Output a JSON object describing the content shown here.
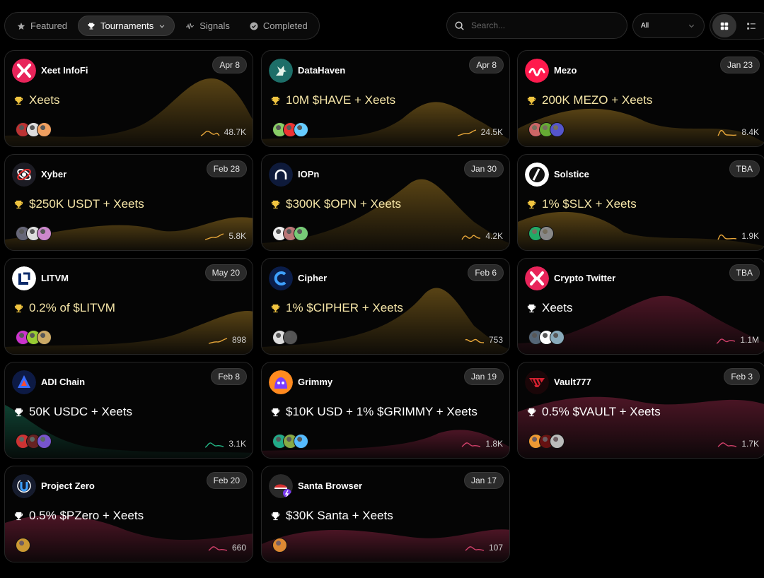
{
  "tabs": [
    {
      "label": "Featured",
      "icon": "star-icon",
      "active": false
    },
    {
      "label": "Tournaments",
      "icon": "trophy-icon",
      "active": true
    },
    {
      "label": "Signals",
      "icon": "signal-wave-icon",
      "active": false
    },
    {
      "label": "Completed",
      "icon": "check-circle-icon",
      "active": false
    }
  ],
  "search": {
    "placeholder": "Search..."
  },
  "filter": {
    "selected": "All"
  },
  "view": {
    "active": "grid"
  },
  "colors": {
    "gold": "#e0a82e",
    "pink": "#c0305a",
    "green": "#1fa37a"
  },
  "cards": [
    {
      "name": "Xeet InfoFi",
      "date": "Apr 8",
      "prize": "Xeets",
      "stat": "48.7K",
      "theme": "gold",
      "logo": "xeet-logo-icon"
    },
    {
      "name": "DataHaven",
      "date": "Apr 8",
      "prize": "10M $HAVE + Xeets",
      "stat": "24.5K",
      "theme": "gold",
      "logo": "datahaven-logo-icon"
    },
    {
      "name": "Mezo",
      "date": "Jan 23",
      "prize": "200K MEZO + Xeets",
      "stat": "8.4K",
      "theme": "gold",
      "logo": "mezo-logo-icon"
    },
    {
      "name": "Xyber",
      "date": "Feb 28",
      "prize": "$250K USDT + Xeets",
      "stat": "5.8K",
      "theme": "gold",
      "logo": "xyber-logo-icon"
    },
    {
      "name": "IOPn",
      "date": "Jan 30",
      "prize": "$300K $OPN + Xeets",
      "stat": "4.2K",
      "theme": "gold",
      "logo": "iopn-logo-icon"
    },
    {
      "name": "Solstice",
      "date": "TBA",
      "prize": "1% $SLX + Xeets",
      "stat": "1.9K",
      "theme": "gold",
      "logo": "solstice-logo-icon"
    },
    {
      "name": "LITVM",
      "date": "May 20",
      "prize": "0.2% of $LITVM",
      "stat": "898",
      "theme": "gold",
      "logo": "litvm-logo-icon"
    },
    {
      "name": "Cipher",
      "date": "Feb 6",
      "prize": "1% $CIPHER + Xeets",
      "stat": "753",
      "theme": "gold",
      "logo": "cipher-logo-icon"
    },
    {
      "name": "Crypto Twitter",
      "date": "TBA",
      "prize": "Xeets",
      "stat": "1.1M",
      "theme": "pink",
      "logo": "crypto-twitter-logo-icon"
    },
    {
      "name": "ADI Chain",
      "date": "Feb 8",
      "prize": "50K USDC + Xeets",
      "stat": "3.1K",
      "theme": "green",
      "logo": "adi-chain-logo-icon"
    },
    {
      "name": "Grimmy",
      "date": "Jan 19",
      "prize": "$10K USD + 1% $GRIMMY + Xeets",
      "stat": "1.8K",
      "theme": "pink",
      "logo": "grimmy-logo-icon"
    },
    {
      "name": "Vault777",
      "date": "Feb 3",
      "prize": "0.5% $VAULT + Xeets",
      "stat": "1.7K",
      "theme": "pink",
      "logo": "vault777-logo-icon"
    },
    {
      "name": "Project Zero",
      "date": "Feb 20",
      "prize": "0.5% $PZero + Xeets",
      "stat": "660",
      "theme": "pink",
      "logo": "project-zero-logo-icon"
    },
    {
      "name": "Santa Browser",
      "date": "Jan 17",
      "prize": "$30K Santa + Xeets",
      "stat": "107",
      "theme": "pink",
      "logo": "santa-browser-logo-icon"
    }
  ]
}
